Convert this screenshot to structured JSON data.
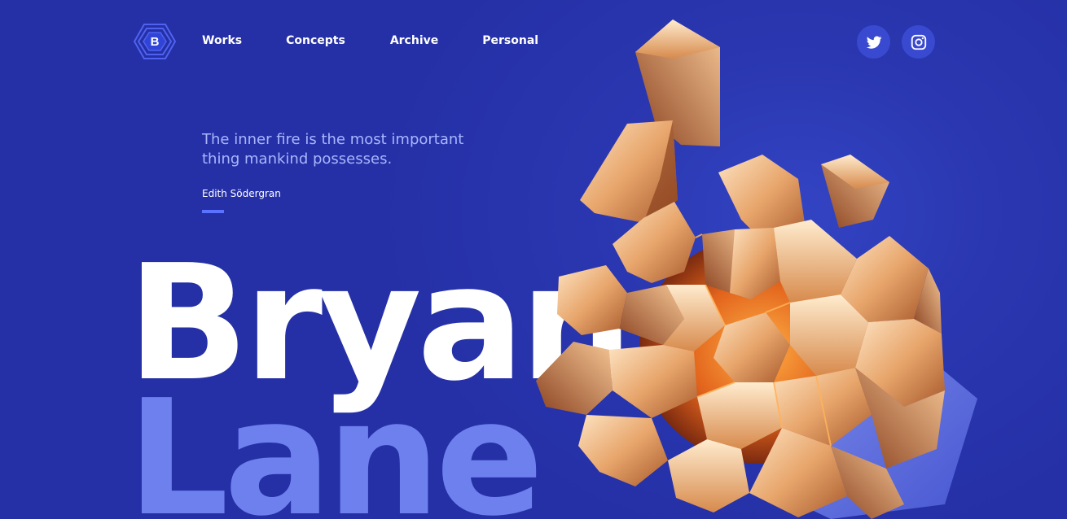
{
  "brand": {
    "logo_letter": "B"
  },
  "nav": {
    "items": [
      {
        "label": "Works"
      },
      {
        "label": "Concepts"
      },
      {
        "label": "Archive"
      },
      {
        "label": "Personal"
      }
    ]
  },
  "social": {
    "twitter_icon": "twitter-icon",
    "instagram_icon": "instagram-icon"
  },
  "hero": {
    "quote_line1": "The inner fire is the most important",
    "quote_line2": "thing mankind possesses.",
    "author": "Edith Södergran",
    "name_first": "Bryan",
    "name_last": "Lane"
  },
  "colors": {
    "background": "#2a37b0",
    "accent": "#5a72ff",
    "quote_text": "#aab6ff",
    "name_secondary": "#6e80ee",
    "copper": "#e9a46a"
  }
}
